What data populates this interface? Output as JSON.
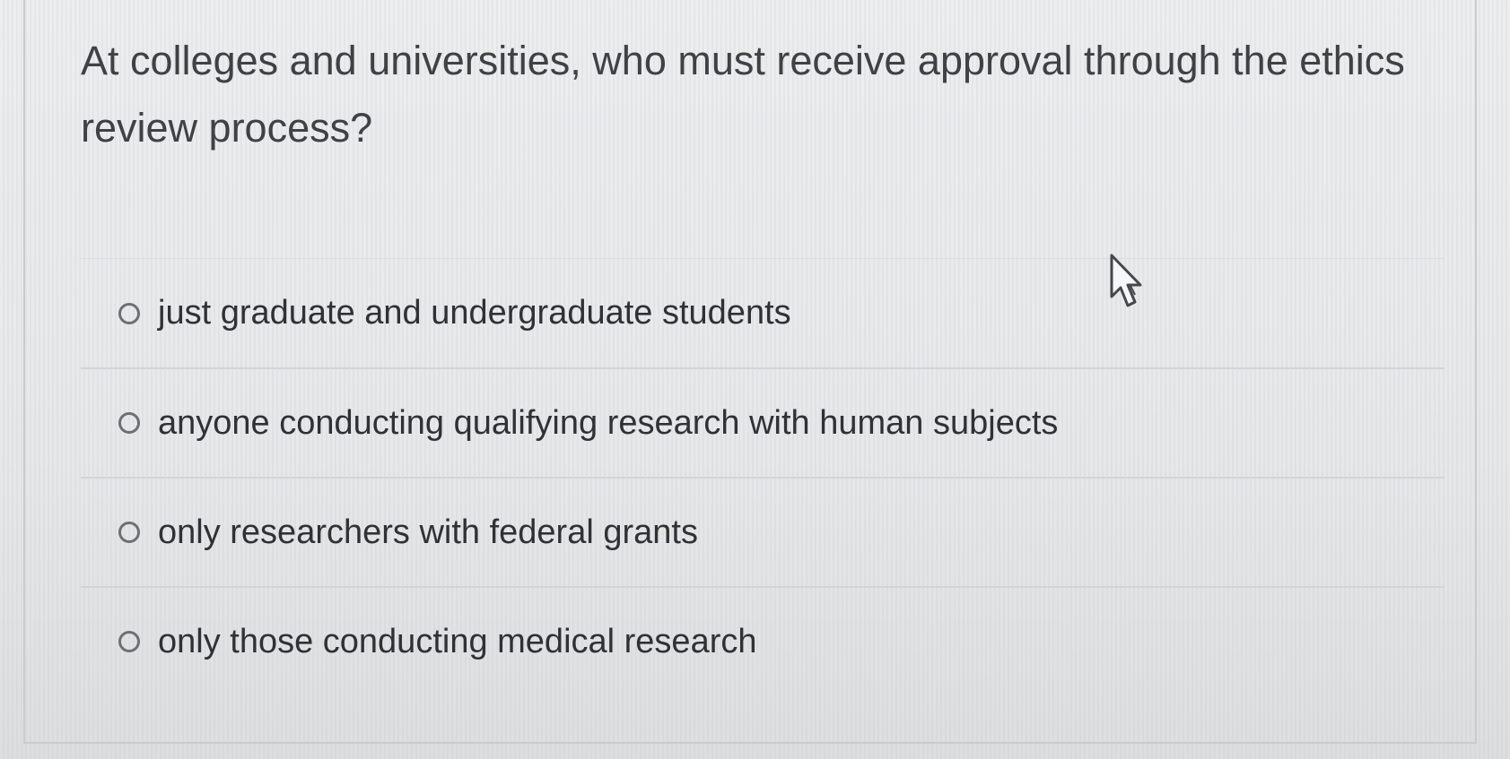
{
  "question": {
    "text": "At colleges and universities, who must receive approval through the ethics review process?"
  },
  "answers": [
    {
      "label": "just graduate and undergraduate students",
      "selected": false
    },
    {
      "label": "anyone conducting qualifying research with human subjects",
      "selected": false
    },
    {
      "label": "only researchers with federal grants",
      "selected": false
    },
    {
      "label": "only those conducting medical research",
      "selected": false
    }
  ],
  "cursor": {
    "icon": "hand-pointer-icon"
  }
}
